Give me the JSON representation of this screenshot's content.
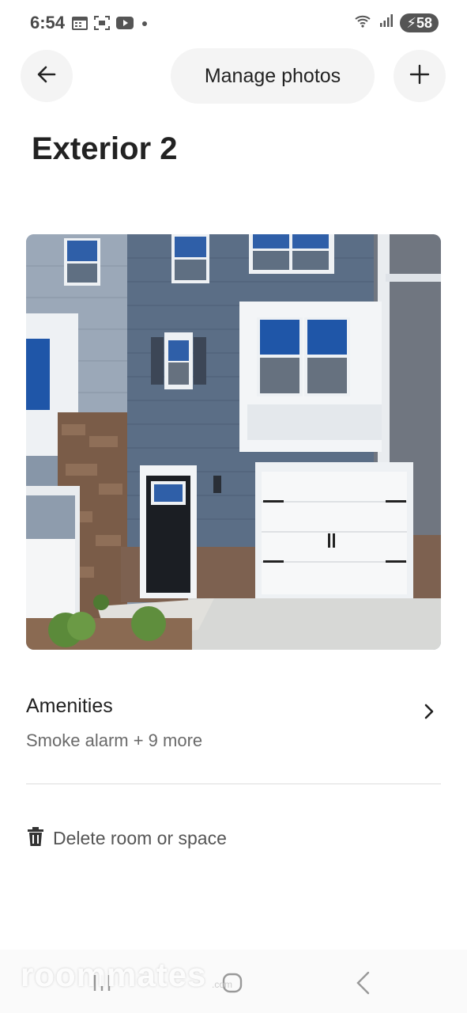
{
  "status_bar": {
    "time": "6:54",
    "battery": "58",
    "left_icons": [
      "calendar-icon",
      "screenshot-icon",
      "youtube-icon",
      "dot-icon"
    ],
    "right_icons": [
      "wifi-icon",
      "signal-icon",
      "battery-icon"
    ]
  },
  "toolbar": {
    "manage_label": "Manage photos",
    "back_icon": "arrow-left-icon",
    "add_icon": "plus-icon"
  },
  "page": {
    "title": "Exterior 2"
  },
  "amenities": {
    "title": "Amenities",
    "summary": "Smoke alarm + 9 more"
  },
  "delete": {
    "label": "Delete room or space"
  },
  "watermark": {
    "text": "roommates",
    "sub": ".com"
  },
  "colors": {
    "text_primary": "#222222",
    "text_secondary": "#6a6a6a",
    "button_bg": "#f4f4f4",
    "siding": "#5c6f86",
    "stone": "#7a5c48"
  }
}
